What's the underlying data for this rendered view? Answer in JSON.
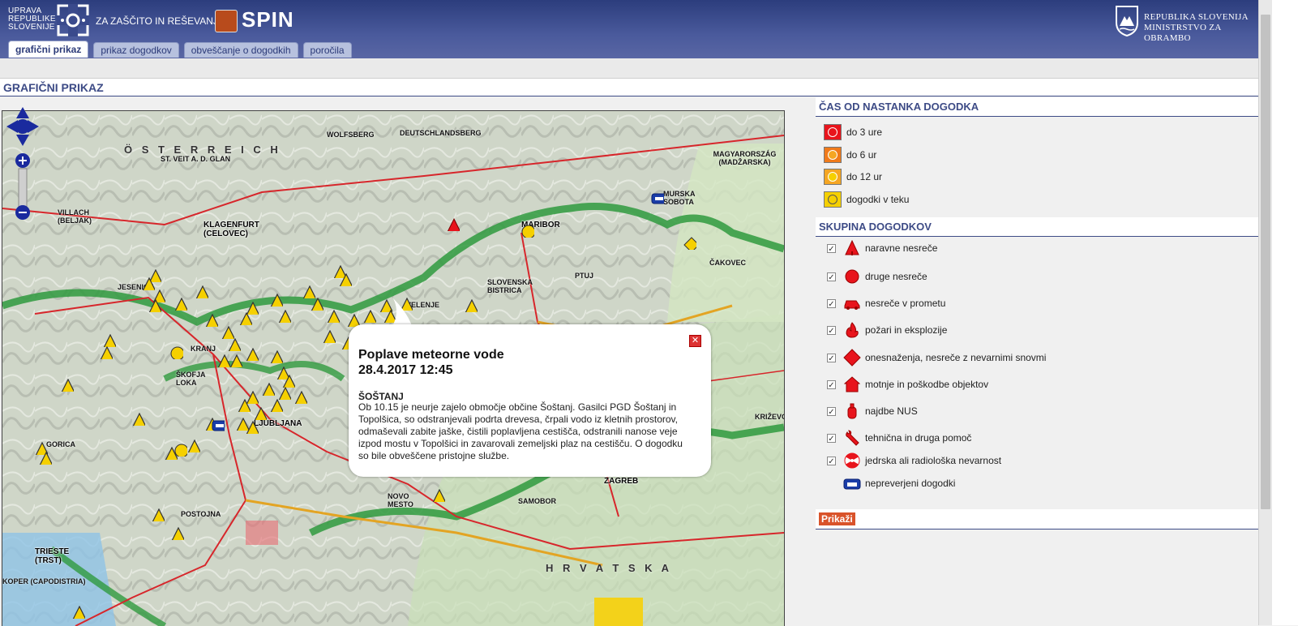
{
  "header": {
    "org_line1": "UPRAVA",
    "org_line2": "REPUBLIKE",
    "org_line3": "SLOVENIJE",
    "org_sub": "ZA ZAŠČITO IN REŠEVANJE",
    "app_name": "SPIN",
    "ministry_line1": "REPUBLIKA SLOVENIJA",
    "ministry_line2": "MINISTRSTVO ZA OBRAMBO"
  },
  "tabs": [
    {
      "label": "grafični prikaz",
      "active": true
    },
    {
      "label": "prikaz dogodkov",
      "active": false
    },
    {
      "label": "obveščanje o dogodkih",
      "active": false
    },
    {
      "label": "poročila",
      "active": false
    }
  ],
  "page_title": "GRAFIČNI PRIKAZ",
  "map": {
    "labels": [
      "Ö S T E R R E I C H",
      "MAGYARORSZÁG (MADŽARSKA)",
      "H R V A T S K A",
      "KLAGENFURT (CELOVEC)",
      "VILLACH (BELJAK)",
      "MARIBOR",
      "LJUBLJANA",
      "KRANJ",
      "ZAGREB",
      "TRIESTE (TRST)",
      "PTUJ",
      "VELENJE",
      "MURSKA SOBOTA",
      "WOLFSBERG",
      "DEUTSCHLANDSBERG",
      "ST. VEIT A. D. GLAN",
      "JESENICE",
      "ŠKOFJA LOKA",
      "NOVO MESTO",
      "GORICA",
      "KOPER (CAPODISTRIA)",
      "SAMOBOR",
      "KRIŽEVCI",
      "ČAKOVEC",
      "SLOVENSKA BISTRICA",
      "POSTOJNA"
    ]
  },
  "popup": {
    "title_line1": "Poplave meteorne vode",
    "title_line2": "28.4.2017 12:45",
    "location": "ŠOŠTANJ",
    "description": "Ob 10.15 je neurje zajelo območje občine Šoštanj. Gasilci PGD Šoštanj in Topolšica, so odstranjevali podrta drevesa, črpali vodo iz kletnih prostorov, odmaševali zabite jaške, čistili poplavljena cestišča, odstranili nanose veje izpod mostu v Topolšici in zavarovali zemeljski plaz na cestišču. O dogodku so bile obveščene pristojne službe."
  },
  "legend": {
    "time_title": "ČAS OD NASTANKA DOGODKA",
    "time_items": [
      {
        "label": "do 3 ure",
        "color": "#e8141c"
      },
      {
        "label": "do 6 ur",
        "color": "#f07a1a"
      },
      {
        "label": "do 12 ur",
        "color": "#f5a623"
      },
      {
        "label": "dogodki v teku",
        "color": "#f5d000"
      }
    ],
    "group_title": "SKUPINA DOGODKOV",
    "groups": [
      {
        "label": "naravne nesreče",
        "checked": true,
        "icon": "tree-icon"
      },
      {
        "label": "druge nesreče",
        "checked": true,
        "icon": "circle-icon"
      },
      {
        "label": "nesreče v prometu",
        "checked": true,
        "icon": "car-icon"
      },
      {
        "label": "požari in eksplozije",
        "checked": true,
        "icon": "fire-icon"
      },
      {
        "label": "onesnaženja, nesreče z nevarnimi snovmi",
        "checked": true,
        "icon": "diamond-icon"
      },
      {
        "label": "motnje in poškodbe objektov",
        "checked": true,
        "icon": "house-icon"
      },
      {
        "label": "najdbe NUS",
        "checked": true,
        "icon": "bomb-icon"
      },
      {
        "label": "tehnična in druga pomoč",
        "checked": true,
        "icon": "wrench-icon"
      },
      {
        "label": "jedrska ali radiološka nevarnost",
        "checked": true,
        "icon": "radiation-icon"
      },
      {
        "label": "nepreverjeni dogodki",
        "checked": false,
        "icon": "phone-icon"
      }
    ],
    "checkmark": "✓",
    "show_button": "Prikaži"
  },
  "colors": {
    "header": "#3a4a8c",
    "accent": "#3d4b86",
    "marker_yellow": "#f5d000",
    "marker_red": "#e8141c"
  }
}
